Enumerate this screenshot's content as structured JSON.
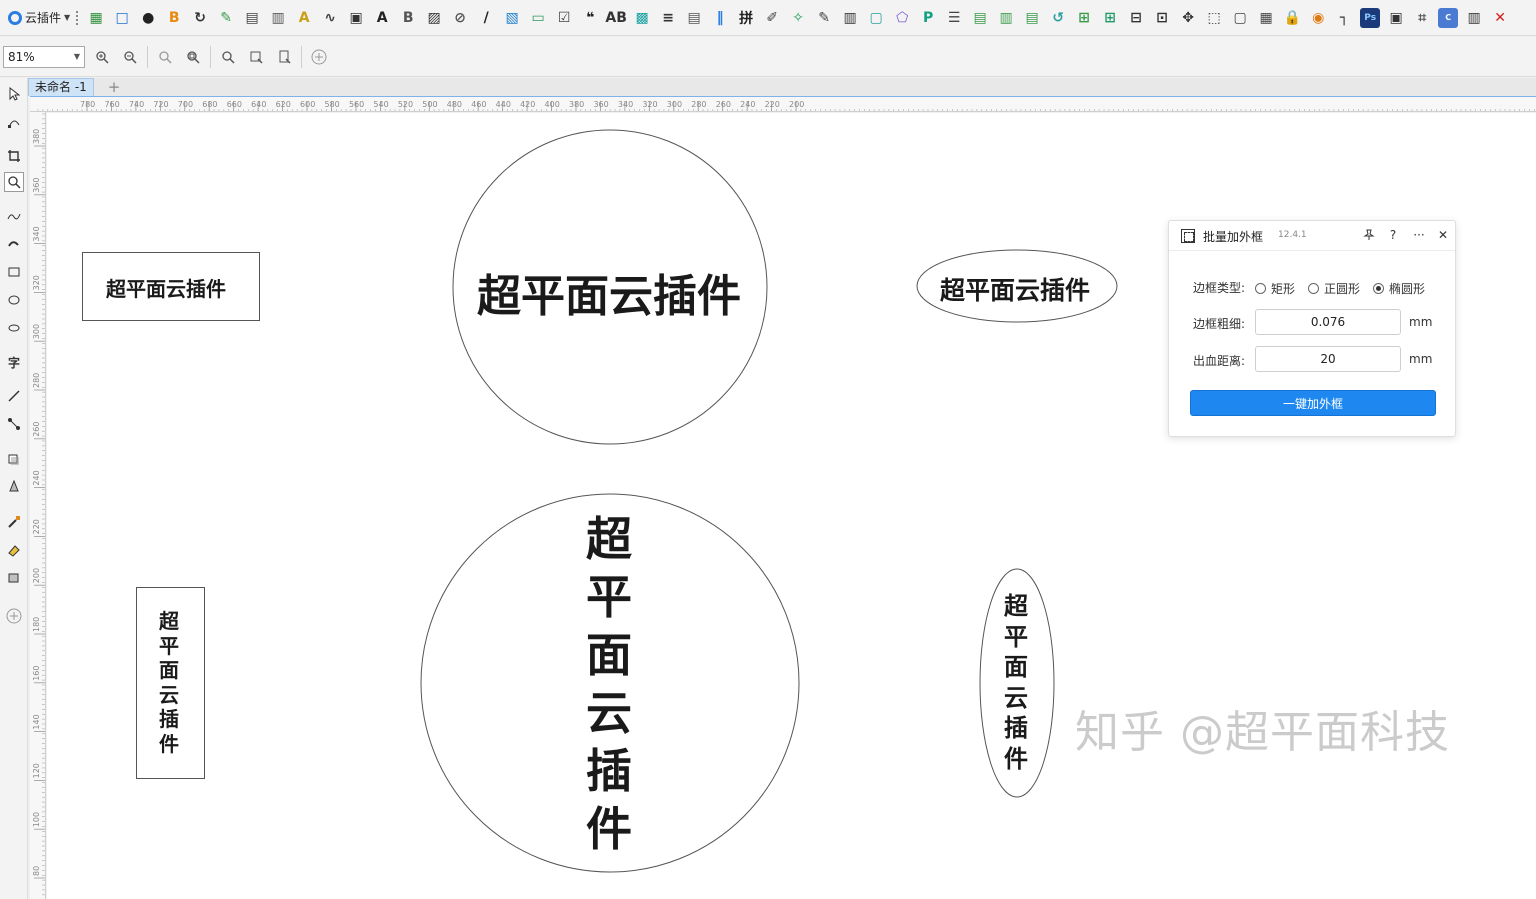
{
  "app": {
    "plugin_menu_label": "云插件",
    "watermark": "知乎 @超平面科技"
  },
  "toolbar": {
    "zoom_value": "81%",
    "plugin_icons": [
      "grid-icon",
      "rectangle-icon",
      "badge-123-icon",
      "bold-b-icon",
      "refresh-icon",
      "pen-a-icon",
      "pdf-icon",
      "layout-icon",
      "text-a-icon",
      "curve-icon",
      "image-icon",
      "text-bold-a-icon",
      "text-b-icon",
      "image-frame-icon",
      "link-icon",
      "italic-icon",
      "picture-icon",
      "monitor-icon",
      "checkbox-icon",
      "quote-icon",
      "ab-icon",
      "qr-icon",
      "text-align-icon",
      "document-icon",
      "bars-icon",
      "join-icon",
      "edit-icon",
      "nodes-icon",
      "node-edit-icon",
      "crop-icon",
      "frame-icon",
      "shape-icon",
      "p-circle-icon",
      "lines-icon",
      "group-icon",
      "align-icon",
      "layers-icon",
      "rotate-icon",
      "fit-icon",
      "grid-line-icon",
      "expand-icon",
      "copy-icon",
      "move-icon",
      "selection-icon",
      "box-icon",
      "transform-icon",
      "lock-icon",
      "color-icon",
      "corner-icon",
      "ps-icon",
      "bitmap-icon",
      "resize-icon",
      "cdr-icon",
      "columns-icon",
      "export-icon"
    ]
  },
  "document": {
    "tab_label": "未命名 -1"
  },
  "ruler": {
    "h_labels": [
      "780",
      "760",
      "740",
      "720",
      "700",
      "680",
      "660",
      "640",
      "620",
      "600",
      "580",
      "560",
      "540",
      "520",
      "500",
      "480",
      "460",
      "440",
      "420",
      "400",
      "380",
      "360",
      "340",
      "320",
      "300",
      "280",
      "260",
      "240",
      "220",
      "200"
    ],
    "v_labels": [
      "380",
      "360",
      "340",
      "320",
      "300",
      "280",
      "260",
      "240",
      "220",
      "200",
      "180",
      "160",
      "140",
      "120",
      "100",
      "80"
    ]
  },
  "canvas": {
    "items": [
      {
        "id": "rect-horizontal",
        "shape": "rectangle",
        "text": "超平面云插件",
        "orientation": "horizontal"
      },
      {
        "id": "circle-horizontal",
        "shape": "circle",
        "text": "超平面云插件",
        "orientation": "horizontal"
      },
      {
        "id": "ellipse-horizontal",
        "shape": "ellipse",
        "text": "超平面云插件",
        "orientation": "horizontal"
      },
      {
        "id": "rect-vertical",
        "shape": "rectangle",
        "text": "超平面云插件",
        "orientation": "vertical"
      },
      {
        "id": "circle-vertical",
        "shape": "circle",
        "text": "超平面云插件",
        "orientation": "vertical"
      },
      {
        "id": "ellipse-vertical",
        "shape": "ellipse",
        "text": "超平面云插件",
        "orientation": "vertical"
      }
    ]
  },
  "dialog": {
    "title": "批量加外框",
    "version": "12.4.1",
    "border_type_label": "边框类型:",
    "border_type_options": [
      "矩形",
      "正圆形",
      "椭圆形"
    ],
    "border_type_selected": "椭圆形",
    "border_width_label": "边框粗细:",
    "border_width_value": "0.076",
    "border_width_unit": "mm",
    "bleed_label": "出血距离:",
    "bleed_value": "20",
    "bleed_unit": "mm",
    "action_label": "一键加外框",
    "colors": {
      "action": "#1e88f0"
    }
  }
}
